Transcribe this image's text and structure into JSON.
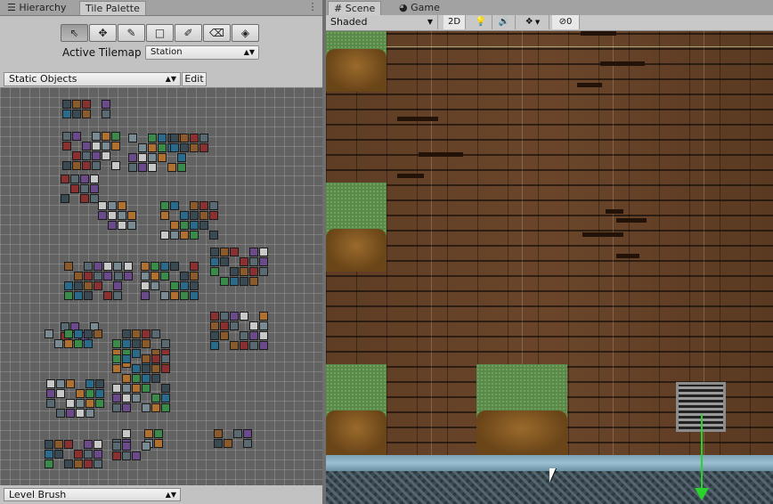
{
  "left_tabs": {
    "hierarchy": "Hierarchy",
    "tile_palette": "Tile Palette"
  },
  "right_tabs": {
    "scene": "Scene",
    "game": "Game"
  },
  "tools": [
    "select-tool-icon",
    "move-tool-icon",
    "paintbrush-tool-icon",
    "box-fill-tool-icon",
    "picker-tool-icon",
    "eraser-tool-icon",
    "fill-tool-icon"
  ],
  "tool_glyphs": [
    "⇖",
    "✥",
    "✎",
    "□",
    "✐",
    "⌫",
    "◈"
  ],
  "active_tilemap": {
    "label": "Active Tilemap",
    "value": "Station"
  },
  "palette": {
    "selected": "Static Objects",
    "edit_label": "Edit"
  },
  "brush": {
    "selected": "Level Brush"
  },
  "scene_toolbar": {
    "shading_mode": "Shaded",
    "mode_2d": "2D",
    "lighting_icon": "💡",
    "audio_icon": "🔊",
    "effects_icon": "❖",
    "hidden_count": "0"
  },
  "colors": {
    "panel": "#c2c2c2",
    "palette_bg": "#626262",
    "wood": "#5e3d24",
    "grass": "#5a8a4a",
    "water": "#8ab0c4",
    "gizmo": "#2ad32a"
  }
}
